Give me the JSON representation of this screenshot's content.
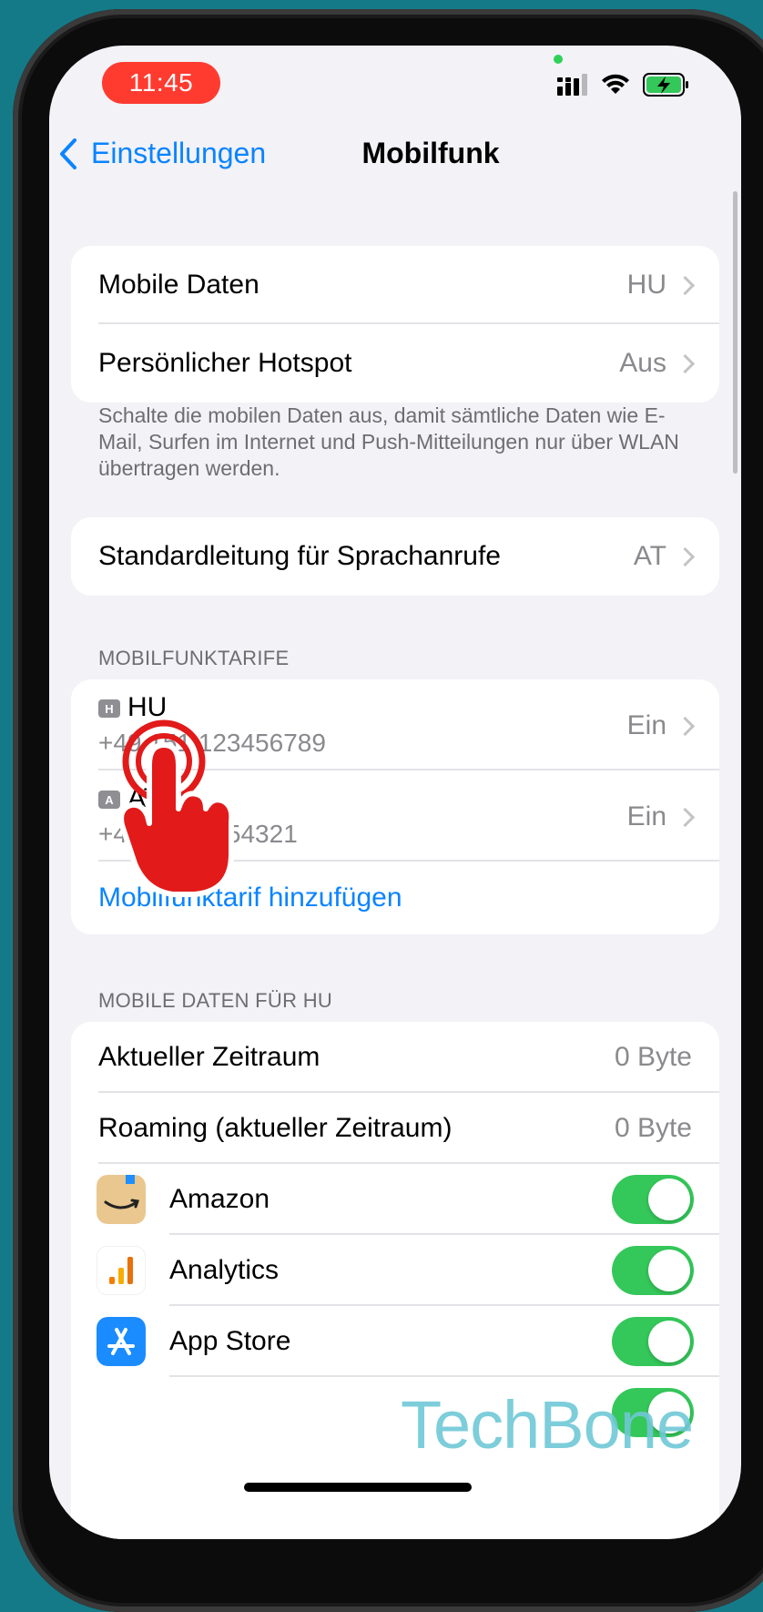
{
  "status_bar": {
    "time": "11:45"
  },
  "nav": {
    "back_label": "Einstellungen",
    "title": "Mobilfunk"
  },
  "group1": {
    "rows": [
      {
        "label": "Mobile Daten",
        "value": "HU"
      },
      {
        "label": "Persönlicher Hotspot",
        "value": "Aus"
      }
    ],
    "footer": "Schalte die mobilen Daten aus, damit sämtliche Daten wie E-Mail, Surfen im Internet und Push-Mitteilungen nur über WLAN übertragen werden."
  },
  "group2": {
    "label": "Standardleitung für Sprachanrufe",
    "value": "AT"
  },
  "tariffs": {
    "header": "MOBILFUNKTARIFE",
    "items": [
      {
        "badge": "H",
        "name": "HU",
        "number": "+49 151 123456789",
        "value": "Ein"
      },
      {
        "badge": "A",
        "name": "AT",
        "number": "+43 664 7654321",
        "value": "Ein"
      }
    ],
    "add_label": "Mobilfunktarif hinzufügen"
  },
  "data_section": {
    "header": "MOBILE DATEN FÜR HU",
    "rows": [
      {
        "label": "Aktueller Zeitraum",
        "value": "0 Byte"
      },
      {
        "label": "Roaming (aktueller Zeitraum)",
        "value": "0 Byte"
      }
    ],
    "apps": [
      {
        "name": "Amazon",
        "icon": "amazon-app-icon",
        "enabled": true
      },
      {
        "name": "Analytics",
        "icon": "analytics-app-icon",
        "enabled": true
      },
      {
        "name": "App Store",
        "icon": "app-store-app-icon",
        "enabled": true
      }
    ]
  },
  "watermark": "TechBone",
  "colors": {
    "accent": "#0a84ff",
    "toggle_on": "#34c759",
    "time_pill": "#ff3b30",
    "background": "#157a88"
  }
}
